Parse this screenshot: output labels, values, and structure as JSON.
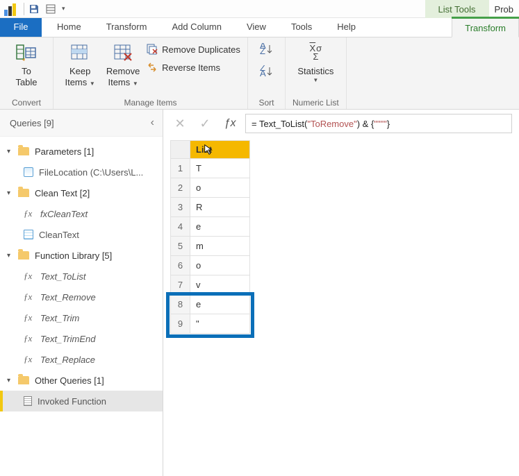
{
  "titlebar": {
    "context_tab_group": "List Tools",
    "trailing_text": "Prob",
    "qat_dropdown": "▾"
  },
  "tabs": {
    "file": "File",
    "items": [
      "Home",
      "Transform",
      "Add Column",
      "View",
      "Tools",
      "Help"
    ],
    "context_tab": "Transform"
  },
  "ribbon": {
    "convert": {
      "to_table_line1": "To",
      "to_table_line2": "Table",
      "group_label": "Convert"
    },
    "manage": {
      "keep_line1": "Keep",
      "keep_line2": "Items",
      "remove_line1": "Remove",
      "remove_line2": "Items",
      "remove_dup": "Remove Duplicates",
      "reverse": "Reverse Items",
      "group_label": "Manage Items"
    },
    "sort": {
      "group_label": "Sort"
    },
    "numeric": {
      "stats": "Statistics",
      "group_label": "Numeric List"
    }
  },
  "sidebar": {
    "header": "Queries [9]",
    "groups": [
      {
        "name": "Parameters [1]",
        "items": [
          {
            "label": "FileLocation (C:\\Users\\L...",
            "icon": "param"
          }
        ]
      },
      {
        "name": "Clean Text [2]",
        "items": [
          {
            "label": "fxCleanText",
            "icon": "fx"
          },
          {
            "label": "CleanText",
            "icon": "table"
          }
        ]
      },
      {
        "name": "Function Library [5]",
        "items": [
          {
            "label": "Text_ToList",
            "icon": "fx"
          },
          {
            "label": "Text_Remove",
            "icon": "fx"
          },
          {
            "label": "Text_Trim",
            "icon": "fx"
          },
          {
            "label": "Text_TrimEnd",
            "icon": "fx"
          },
          {
            "label": "Text_Replace",
            "icon": "fx"
          }
        ]
      },
      {
        "name": "Other Queries [1]",
        "items": [
          {
            "label": "Invoked Function",
            "icon": "list",
            "selected": true
          }
        ]
      }
    ]
  },
  "formula": {
    "prefix": "= Text_ToList(",
    "string1": "\"ToRemove\"",
    "mid": ") & {",
    "string2": "\"\"\"\"",
    "suffix": "}"
  },
  "list": {
    "header": "List",
    "rows": [
      "T",
      "o",
      "R",
      "e",
      "m",
      "o",
      "v",
      "e",
      "\""
    ]
  }
}
